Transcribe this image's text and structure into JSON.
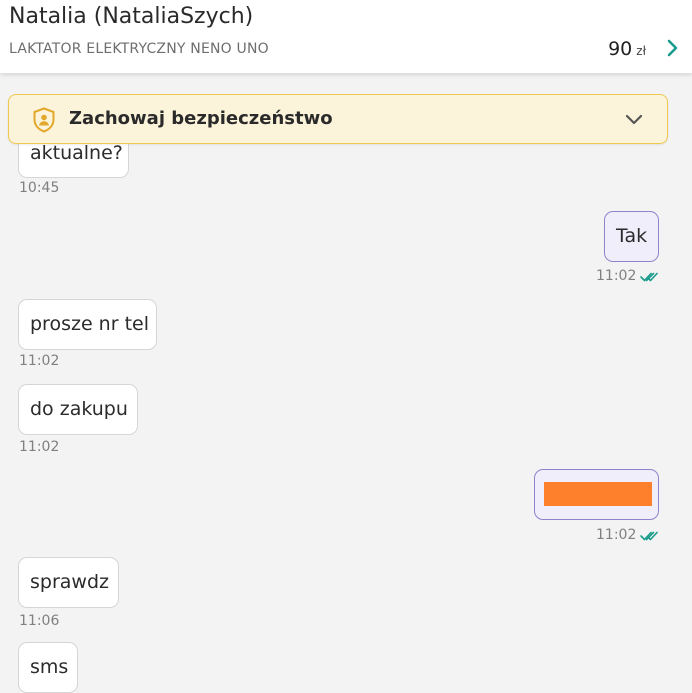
{
  "header": {
    "contact_name": "Natalia (NataliaSzych)",
    "item_title": "LAKTATOR ELEKTRYCZNY NENO UNO",
    "price": "90",
    "currency": "zł"
  },
  "safety_banner": {
    "label": "Zachowaj bezpieczeństwo"
  },
  "messages": [
    {
      "dir": "in",
      "text": "aktualne?",
      "time": "10:45"
    },
    {
      "dir": "out",
      "text": "Tak",
      "time": "11:02"
    },
    {
      "dir": "in",
      "text": "prosze nr tel",
      "time": "11:02"
    },
    {
      "dir": "in",
      "text": "do zakupu",
      "time": "11:02"
    },
    {
      "dir": "out",
      "text": "",
      "time": "11:02",
      "redacted": true
    },
    {
      "dir": "in",
      "text": "sprawdz",
      "time": "11:06"
    },
    {
      "dir": "in",
      "text": "sms",
      "time": ""
    }
  ],
  "colors": {
    "accent_teal": "#1a9c8c",
    "outgoing_border": "#8d84cc",
    "banner_border": "#f0c84e",
    "redaction": "#fe7f2c"
  },
  "icons": {
    "shield": "shield-user-icon",
    "read_receipt": "double-check-icon"
  }
}
